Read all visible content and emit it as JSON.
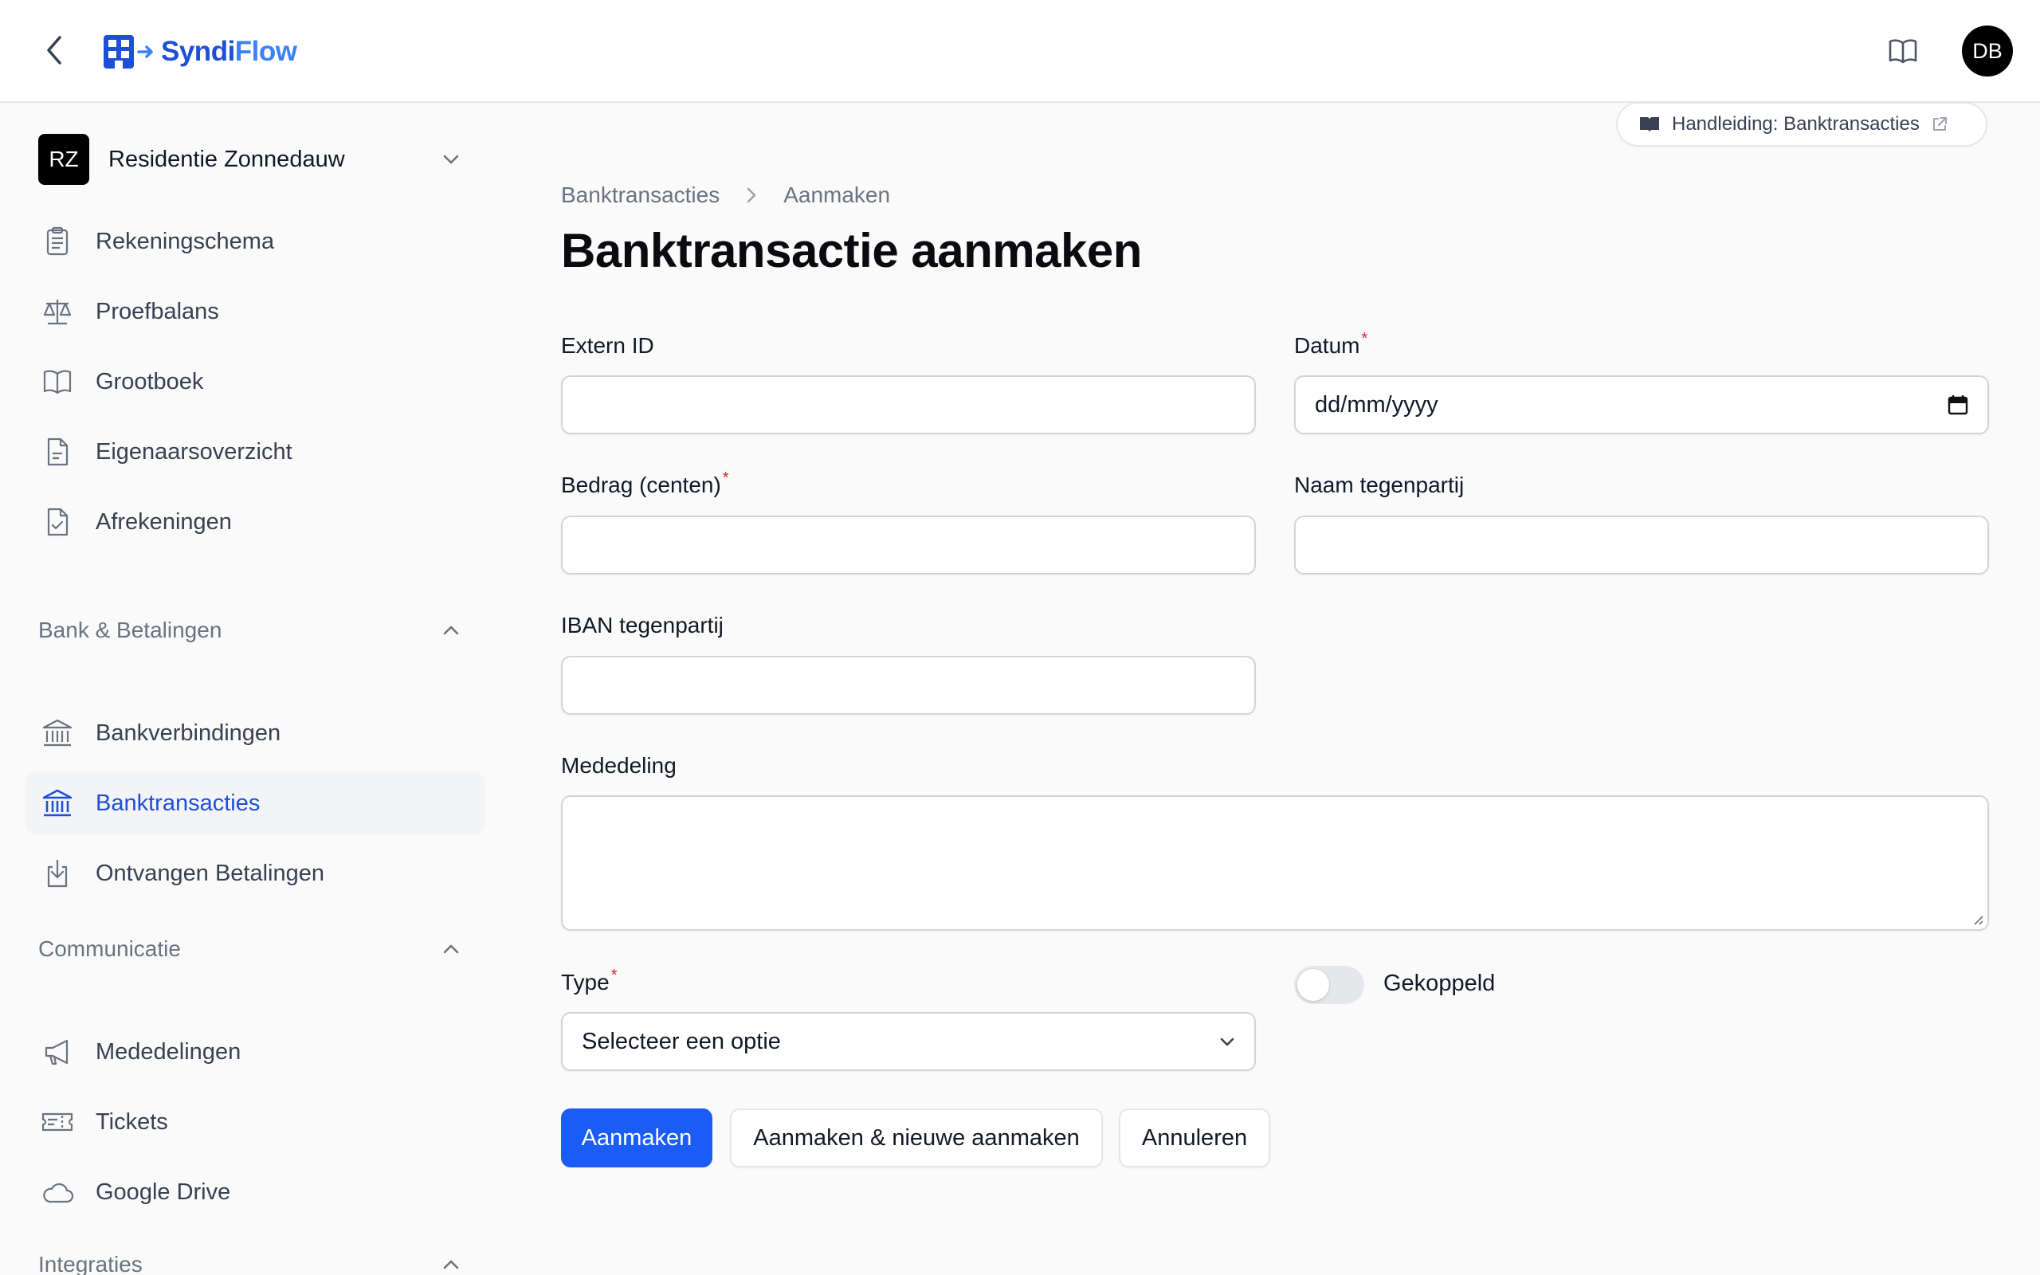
{
  "app": {
    "logo_part1": "Syndi",
    "logo_part2": "Flow",
    "user_initials": "DB"
  },
  "tenant": {
    "initials": "RZ",
    "name": "Residentie Zonnedauw"
  },
  "sidebar": {
    "items": [
      {
        "label": "Rekeningschema",
        "icon": "clipboard-list-icon"
      },
      {
        "label": "Proefbalans",
        "icon": "scale-icon"
      },
      {
        "label": "Grootboek",
        "icon": "book-open-icon"
      },
      {
        "label": "Eigenaarsoverzicht",
        "icon": "document-text-icon"
      },
      {
        "label": "Afrekeningen",
        "icon": "document-check-icon"
      }
    ],
    "groups": [
      {
        "label": "Bank & Betalingen",
        "items": [
          {
            "label": "Bankverbindingen",
            "icon": "bank-icon",
            "active": false
          },
          {
            "label": "Banktransacties",
            "icon": "bank-icon",
            "active": true
          },
          {
            "label": "Ontvangen Betalingen",
            "icon": "download-document-icon",
            "active": false
          }
        ]
      },
      {
        "label": "Communicatie",
        "items": [
          {
            "label": "Mededelingen",
            "icon": "megaphone-icon"
          },
          {
            "label": "Tickets",
            "icon": "ticket-icon"
          },
          {
            "label": "Google Drive",
            "icon": "cloud-icon"
          }
        ]
      },
      {
        "label": "Integraties",
        "items": []
      }
    ]
  },
  "help": {
    "label": "Handleiding: Banktransacties"
  },
  "breadcrumb": {
    "parent": "Banktransacties",
    "current": "Aanmaken"
  },
  "page": {
    "title": "Banktransactie aanmaken"
  },
  "form": {
    "extern_id": {
      "label": "Extern ID",
      "value": ""
    },
    "datum": {
      "label": "Datum",
      "required": "*",
      "value": "dd/mm/yyyy"
    },
    "bedrag": {
      "label": "Bedrag (centen)",
      "required": "*",
      "value": ""
    },
    "naam": {
      "label": "Naam tegenpartij",
      "value": ""
    },
    "iban": {
      "label": "IBAN tegenpartij",
      "value": ""
    },
    "mededeling": {
      "label": "Mededeling",
      "value": ""
    },
    "type": {
      "label": "Type",
      "required": "*",
      "value": "Selecteer een optie"
    },
    "gekoppeld": {
      "label": "Gekoppeld",
      "on": false
    }
  },
  "actions": {
    "create": "Aanmaken",
    "create_another": "Aanmaken & nieuwe aanmaken",
    "cancel": "Annuleren"
  },
  "colors": {
    "accent": "#1a5cf5",
    "active_text": "#1e4fd8",
    "required": "#dc2626"
  }
}
